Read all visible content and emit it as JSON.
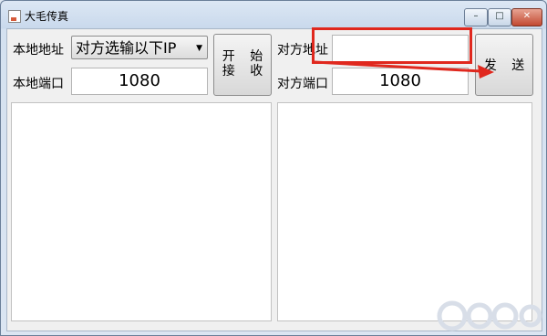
{
  "window": {
    "title": "大毛传真",
    "controls": {
      "minimize": "–",
      "maximize": "□",
      "close": "✕"
    }
  },
  "local": {
    "address_label": "本地地址",
    "address_selected": "对方选输以下IP",
    "port_label": "本地端口",
    "port_value": "1080"
  },
  "start_button": {
    "line1": "开 始",
    "line2": "接 收"
  },
  "remote": {
    "address_label": "对方地址",
    "address_value": "",
    "port_label": "对方端口",
    "port_value": "1080"
  },
  "send_button": {
    "label": "发 送"
  },
  "icons": {
    "dropdown": "triangle-down",
    "app": "app-icon"
  },
  "colors": {
    "highlight": "#e0281e",
    "window_frame": "#6b7f99"
  }
}
